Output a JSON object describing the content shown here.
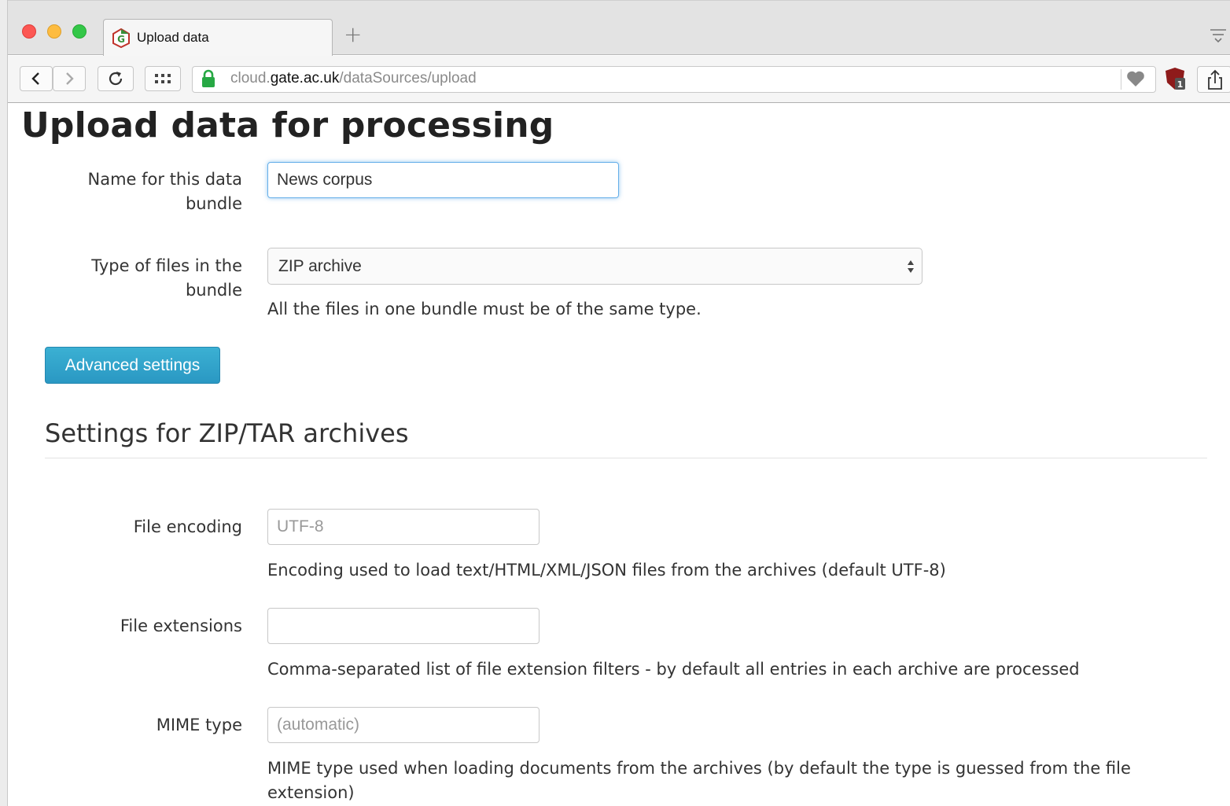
{
  "browser": {
    "tab_title": "Upload data",
    "url_prefix": "cloud.",
    "url_domain": "gate.ac.uk",
    "url_path": "/dataSources/upload"
  },
  "page": {
    "title": "Upload data for processing"
  },
  "form": {
    "name_label_line1": "Name for this data",
    "name_label_line2": "bundle",
    "name_value": "News corpus",
    "type_label_line1": "Type of files in the",
    "type_label_line2": "bundle",
    "type_selected": "ZIP archive",
    "type_help": "All the files in one bundle must be of the same type.",
    "advanced_button": "Advanced settings"
  },
  "archive_settings": {
    "heading": "Settings for ZIP/TAR archives",
    "encoding_label": "File encoding",
    "encoding_placeholder": "UTF-8",
    "encoding_help": "Encoding used to load text/HTML/XML/JSON files from the archives (default UTF-8)",
    "extensions_label": "File extensions",
    "extensions_value": "",
    "extensions_help": "Comma-separated list of file extension filters - by default all entries in each archive are processed",
    "mime_label": "MIME type",
    "mime_placeholder": "(automatic)",
    "mime_help_line1": "MIME type used when loading documents from the archives (by default the type is guessed from the file",
    "mime_help_line2": "extension)"
  },
  "colors": {
    "primary_button": "#2a98c3",
    "focus_ring": "#66afe9",
    "lock_green": "#27a844"
  },
  "icons": [
    "tab-favicon-icon",
    "new-tab-icon",
    "tab-menu-icon",
    "back-icon",
    "forward-icon",
    "reload-icon",
    "top-sites-icon",
    "lock-icon",
    "heart-icon",
    "ublock-icon",
    "share-icon",
    "select-arrows-icon"
  ]
}
